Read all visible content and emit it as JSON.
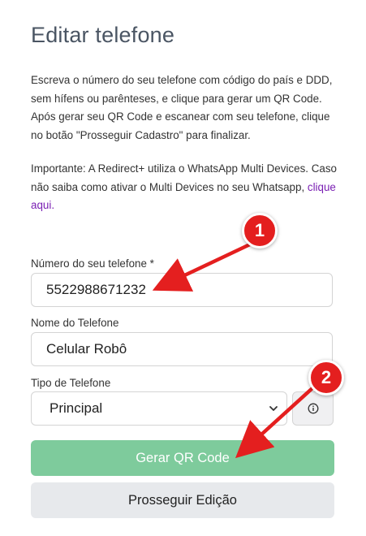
{
  "page": {
    "title": "Editar telefone",
    "instructions": "Escreva o número do seu telefone com código do país e DDD, sem hífens ou parênteses, e clique para gerar um QR Code. Após gerar seu QR Code e escanear com seu telefone, clique no botão \"Prosseguir Cadastro\" para finalizar.",
    "important_text": "Importante: A Redirect+ utiliza o WhatsApp Multi Devices. Caso não saiba como ativar o Multi Devices no seu Whatsapp, ",
    "important_link": "clique aqui."
  },
  "form": {
    "phone_label": "Número do seu telefone *",
    "phone_value": "5522988671232",
    "name_label": "Nome do Telefone",
    "name_value": "Celular Robô",
    "type_label": "Tipo de Telefone",
    "type_value": "Principal"
  },
  "buttons": {
    "generate_qr": "Gerar QR Code",
    "proceed": "Prosseguir Edição"
  },
  "annotations": {
    "badge_1": "1",
    "badge_2": "2",
    "color": "#e41f1f"
  },
  "colors": {
    "primary_button": "#7ecb9c",
    "secondary_button": "#e7e9ec",
    "link": "#7a1fb3"
  }
}
